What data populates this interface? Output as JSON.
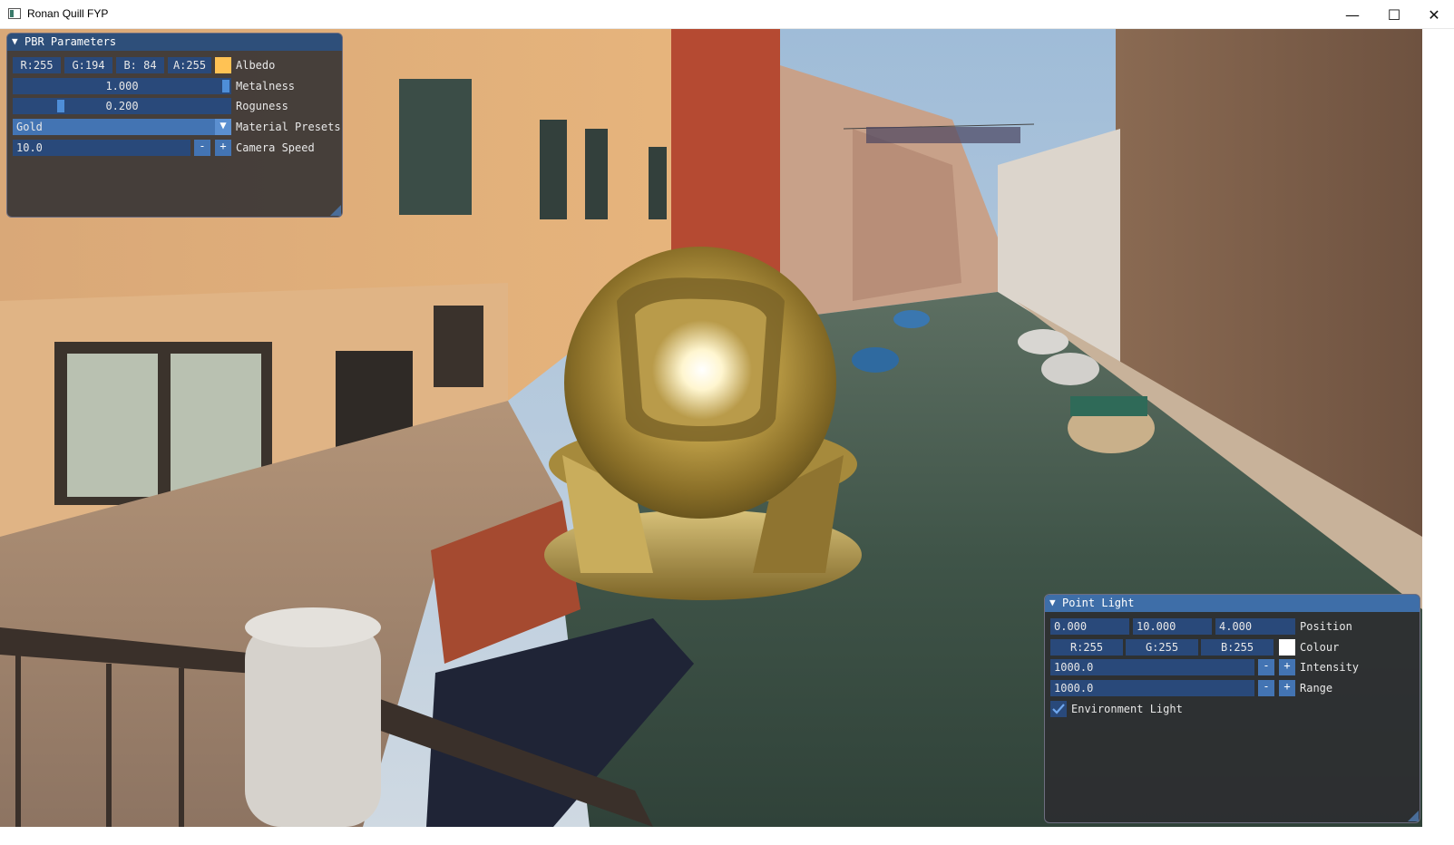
{
  "window": {
    "title": "Ronan Quill FYP",
    "minimize_glyph": "—",
    "maximize_glyph": "☐",
    "close_glyph": "✕"
  },
  "pbr_panel": {
    "title": "PBR Parameters",
    "albedo": {
      "r": "R:255",
      "g": "G:194",
      "b": "B: 84",
      "a": "A:255",
      "label": "Albedo",
      "swatch_color": "#ffc254"
    },
    "metalness": {
      "value": "1.000",
      "label": "Metalness",
      "level": 1.0
    },
    "roughness": {
      "value": "0.200",
      "label": "Roguness",
      "level": 0.2
    },
    "material_preset": {
      "value": "Gold",
      "label": "Material Presets"
    },
    "camera_speed": {
      "value": "10.0",
      "minus": "-",
      "plus": "+",
      "label": "Camera Speed"
    }
  },
  "point_light_panel": {
    "title": "Point Light",
    "position": {
      "x": "0.000",
      "y": "10.000",
      "z": "4.000",
      "label": "Position"
    },
    "colour": {
      "r": "R:255",
      "g": "G:255",
      "b": "B:255",
      "label": "Colour",
      "swatch_color": "#ffffff"
    },
    "intensity": {
      "value": "1000.0",
      "minus": "-",
      "plus": "+",
      "label": "Intensity"
    },
    "range": {
      "value": "1000.0",
      "minus": "-",
      "plus": "+",
      "label": "Range"
    },
    "environment_light": {
      "checked": true,
      "label": "Environment Light"
    }
  },
  "colors": {
    "accent": "#4374b3",
    "field_bg": "#29497a",
    "title_bg": "#2e4f7a",
    "panel_bg": "#2c2c30"
  }
}
